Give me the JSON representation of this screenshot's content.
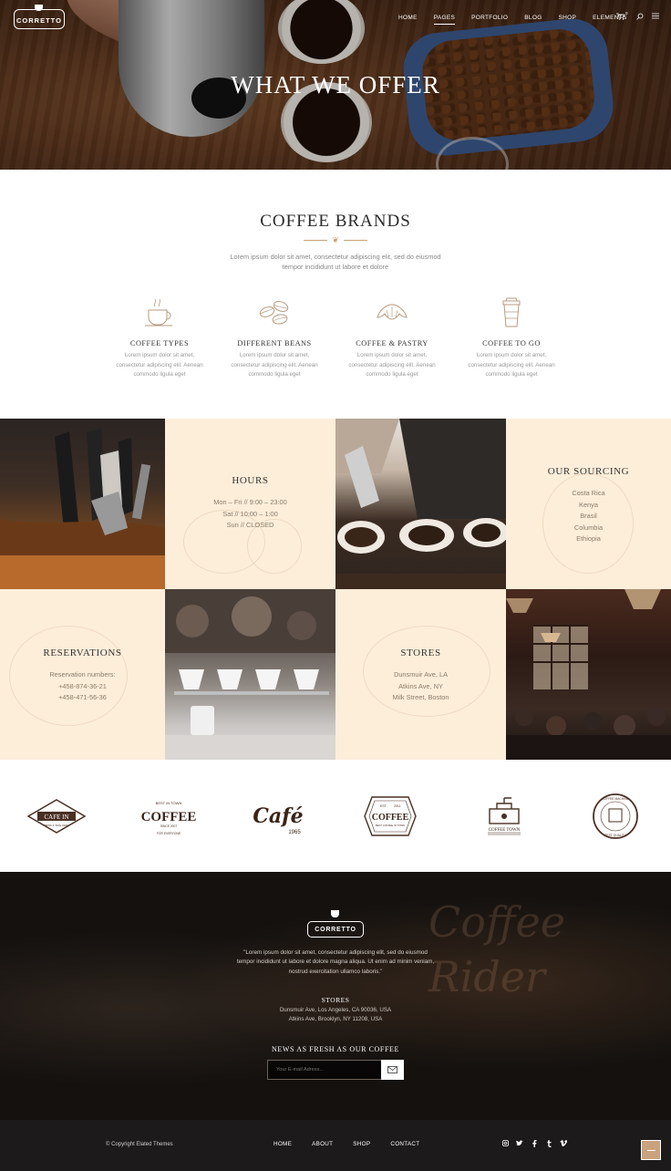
{
  "header": {
    "logo": "CORRETTO",
    "nav": [
      "HOME",
      "PAGES",
      "PORTFOLIO",
      "BLOG",
      "SHOP",
      "ELEMENTS"
    ],
    "active_nav": "PAGES",
    "cart_count": "0",
    "icons": [
      "cart-icon",
      "search-icon",
      "menu-icon"
    ]
  },
  "hero": {
    "title": "WHAT WE OFFER"
  },
  "brands": {
    "title": "COFFEE BRANDS",
    "subtitle": "Lorem ipsum dolor sit amet, consectetur adipiscing elit, sed do eiusmod tempor incididunt ut labore et dolore",
    "features": [
      {
        "title": "COFFEE TYPES",
        "text": "Lorem ipsum dolor sit amet, consectetur adipiscing elit. Aenean commodo ligula eget",
        "icon": "coffee-cup-icon"
      },
      {
        "title": "DIFFERENT BEANS",
        "text": "Lorem ipsum dolor sit amet, consectetur adipiscing elit. Aenean commodo ligula eget",
        "icon": "coffee-beans-icon"
      },
      {
        "title": "COFFEE & PASTRY",
        "text": "Lorem ipsum dolor sit amet, consectetur adipiscing elit. Aenean commodo ligula eget",
        "icon": "croissant-icon"
      },
      {
        "title": "COFFEE TO GO",
        "text": "Lorem ipsum dolor sit amet, consectetur adipiscing elit. Aenean commodo ligula eget",
        "icon": "takeaway-cup-icon"
      }
    ]
  },
  "grid": {
    "hours": {
      "title": "HOURS",
      "lines": [
        "Mon – Fri // 9:00 – 23:00",
        "Sat // 10:00 – 1:00",
        "Sun // CLOSED"
      ]
    },
    "sourcing": {
      "title": "OUR SOURCING",
      "lines": [
        "Costa Rica",
        "Kenya",
        "Brasil",
        "Columbia",
        "Ethiopia"
      ]
    },
    "reservations": {
      "title": "RESERVATIONS",
      "lines": [
        "Reservation numbers:",
        "+458-874-36-21",
        "+458-471-56-36"
      ]
    },
    "stores": {
      "title": "STORES",
      "lines": [
        "Dunsmuir Ave, LA",
        "Atkins Ave, NY",
        "Milk Street, Boston"
      ]
    }
  },
  "partner_logos": {
    "logo1": [
      "CAFE IN",
      "DRINK & TAKE AWAY"
    ],
    "logo2": [
      "BEST IN TOWN",
      "COFFEE",
      "SINCE 2007",
      "FOR EVERYONE"
    ],
    "logo3": [
      "Café",
      "1965"
    ],
    "logo4": [
      "COFFEE",
      "EST",
      "2011",
      "BEST COFFEE IN TOWN"
    ],
    "logo5": [
      "COFFEE TOWN"
    ],
    "logo6": [
      "COFFEE MACHINE",
      "BEST QUALITY"
    ]
  },
  "footer": {
    "logo": "CORRETTO",
    "quote": "\"Lorem ipsum dolor sit amet, consectetur adipiscing elit, sed do eiusmod tempor incididunt ut labore et dolore magna aliqua. Ut enim ad minim veniam, nostrud exercitation ullamco laboris.\"",
    "stores_title": "STORES",
    "addresses": [
      "Dunsmuir Ave, Los Angeles, CA 90036, USA",
      "Atkins Ave, Brooklyn, NY 11208, USA"
    ],
    "newsletter_title": "NEWS AS FRESH AS OUR COFFEE",
    "email_placeholder": "Your E-mail Adress...",
    "bg_sign": [
      "Coffee",
      "Rider"
    ]
  },
  "bottom": {
    "copyright": "© Copyright Elated Themes",
    "nav": [
      "HOME",
      "ABOUT",
      "SHOP",
      "CONTACT"
    ],
    "social": [
      "instagram-icon",
      "twitter-icon",
      "facebook-icon",
      "tumblr-icon",
      "vimeo-icon"
    ]
  },
  "colors": {
    "accent": "#c9a27e",
    "cream": "#fdeeda",
    "dark": "#14110f"
  }
}
